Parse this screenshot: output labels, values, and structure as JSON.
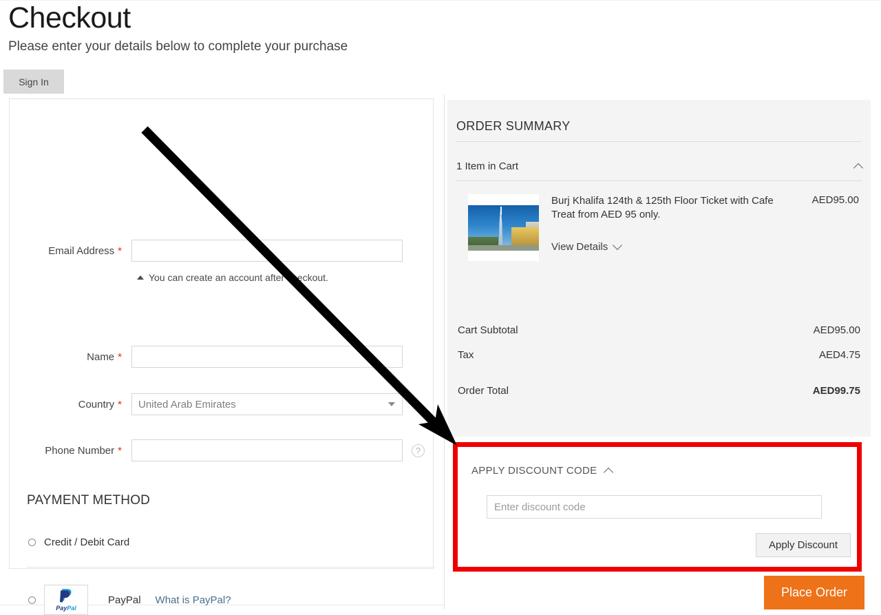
{
  "header": {
    "title": "Checkout",
    "subtitle": "Please enter your details below to complete your purchase",
    "sign_in_label": "Sign In"
  },
  "form": {
    "email": {
      "label": "Email Address",
      "required_mark": "*",
      "value": "",
      "placeholder": ""
    },
    "account_note": "You can create an account after checkout.",
    "name": {
      "label": "Name",
      "required_mark": "*",
      "value": "",
      "placeholder": ""
    },
    "country": {
      "label": "Country",
      "required_mark": "*",
      "selected": "United Arab Emirates",
      "options": [
        "United Arab Emirates"
      ]
    },
    "phone": {
      "label": "Phone Number",
      "required_mark": "*",
      "value": "",
      "placeholder": "",
      "help_icon": "question-mark-icon"
    }
  },
  "payment": {
    "heading": "PAYMENT METHOD",
    "methods": [
      {
        "label": "Credit / Debit Card",
        "selected": false
      },
      {
        "label": "PayPal",
        "selected": false,
        "link_label": "What is PayPal?"
      }
    ],
    "paypal_wordmark_dark": "Pay",
    "paypal_wordmark_light": "Pal"
  },
  "summary": {
    "title": "ORDER SUMMARY",
    "cart_count_label": "1 Item in Cart",
    "cart_toggle_icon": "chevron-up-icon",
    "item": {
      "name": "Burj Khalifa 124th & 125th Floor Ticket with Cafe Treat from AED 95 only.",
      "price": "AED95.00",
      "view_details_label": "View Details",
      "view_details_icon": "chevron-down-icon",
      "thumbnail_alt": "burj-khalifa-photo"
    },
    "totals": [
      {
        "label": "Cart Subtotal",
        "value": "AED95.00"
      },
      {
        "label": "Tax",
        "value": "AED4.75"
      },
      {
        "label": "Order Total",
        "value": "AED99.75"
      }
    ]
  },
  "discount": {
    "toggle_label": "APPLY DISCOUNT CODE",
    "toggle_icon": "chevron-up-icon",
    "input_value": "",
    "input_placeholder": "Enter discount code",
    "apply_button_label": "Apply Discount",
    "highlight_color": "#ee0000"
  },
  "actions": {
    "place_order_label": "Place Order",
    "place_order_color": "#ee7218"
  },
  "annotation": {
    "arrow_color": "#000000",
    "arrow_start": "210,188",
    "arrow_end": "662,645"
  }
}
